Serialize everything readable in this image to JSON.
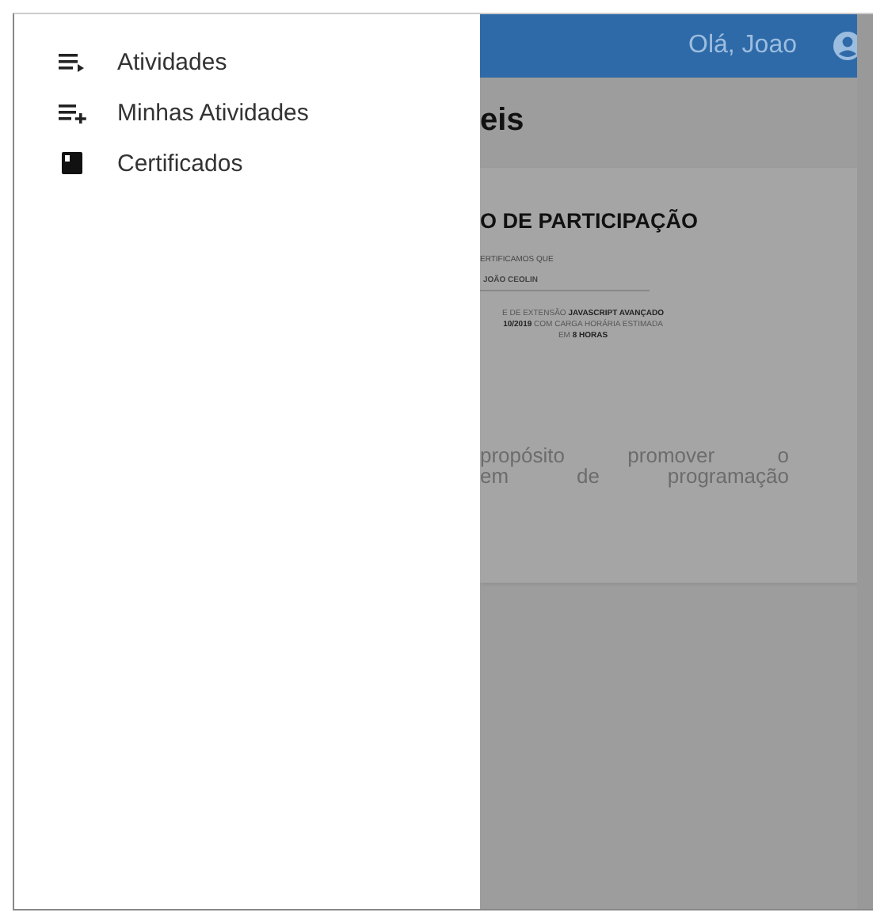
{
  "drawer": {
    "items": [
      {
        "kind": "list-arrow",
        "label": "Atividades"
      },
      {
        "kind": "list-plus",
        "label": "Minhas Atividades"
      },
      {
        "kind": "book",
        "label": "Certificados"
      }
    ]
  },
  "header": {
    "greeting": "Olá, Joao"
  },
  "page": {
    "title": "eis",
    "certificate": {
      "title": "O DE PARTICIPAÇÃO",
      "intro": "ERTIFICAMOS QUE",
      "name": "JOÃO CEOLIN",
      "lines": [
        "E DE EXTENSÃO **JAVASCRIPT AVANÇADO**",
        "**10/2019** COM CARGA HORÁRIA ESTIMADA",
        "EM **8 HORAS**"
      ]
    },
    "description": [
      "propósito promover o",
      "em de programação"
    ]
  }
}
